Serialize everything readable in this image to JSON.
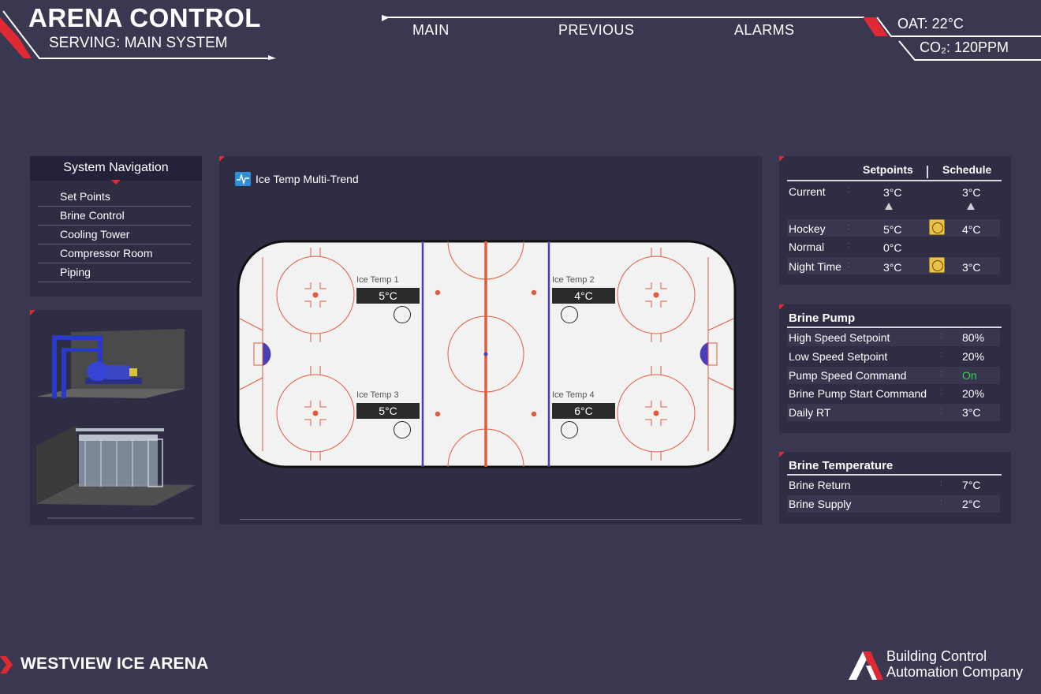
{
  "header": {
    "title": "ARENA CONTROL",
    "subtitle": "SERVING: MAIN SYSTEM",
    "nav": [
      {
        "label": "MAIN"
      },
      {
        "label": "PREVIOUS"
      },
      {
        "label": "ALARMS"
      }
    ],
    "oat": "OAT:  22°C",
    "co2": "CO₂:  120PPM"
  },
  "system_nav": {
    "title": "System Navigation",
    "items": [
      {
        "label": "Set Points"
      },
      {
        "label": "Brine Control"
      },
      {
        "label": "Cooling Tower"
      },
      {
        "label": "Compressor Room"
      },
      {
        "label": "Piping"
      }
    ]
  },
  "rink": {
    "trend_label": "Ice Temp Multi-Trend",
    "sensors": [
      {
        "label": "Ice Temp 1",
        "value": "5°C"
      },
      {
        "label": "Ice Temp 2",
        "value": "4°C"
      },
      {
        "label": "Ice Temp 3",
        "value": "5°C"
      },
      {
        "label": "Ice Temp 4",
        "value": "6°C"
      }
    ]
  },
  "setpoints": {
    "col_setpoints": "Setpoints",
    "col_schedule": "Schedule",
    "rows": [
      {
        "label": "Current",
        "setpoint": "3°C",
        "schedule": "3°C"
      },
      {
        "label": "Hockey",
        "setpoint": "5°C",
        "schedule": "4°C"
      },
      {
        "label": "Normal",
        "setpoint": "0°C",
        "schedule": ""
      },
      {
        "label": "Night Time",
        "setpoint": "3°C",
        "schedule": "3°C"
      }
    ]
  },
  "brine_pump": {
    "title": "Brine Pump",
    "rows": [
      {
        "label": "High Speed Setpoint",
        "value": "80%"
      },
      {
        "label": "Low Speed Setpoint",
        "value": "20%"
      },
      {
        "label": "Pump Speed Command",
        "value": "On"
      },
      {
        "label": "Brine Pump Start Command",
        "value": "20%"
      },
      {
        "label": "Daily RT",
        "value": "3°C"
      }
    ]
  },
  "brine_temperature": {
    "title": "Brine Temperature",
    "rows": [
      {
        "label": "Brine Return",
        "value": "7°C"
      },
      {
        "label": "Brine Supply",
        "value": "2°C"
      }
    ]
  },
  "footer": {
    "arena_name": "WESTVIEW ICE ARENA",
    "company_line1": "Building Control",
    "company_line2": "Automation Company"
  },
  "colors": {
    "background": "#3a3850",
    "panel": "#2f2d44",
    "accent_red": "#e02a33",
    "rink_red": "#e25b3c",
    "rink_blue": "#4b3fb8",
    "status_on": "#2fd24a",
    "clock_button": "#e9c04a"
  }
}
